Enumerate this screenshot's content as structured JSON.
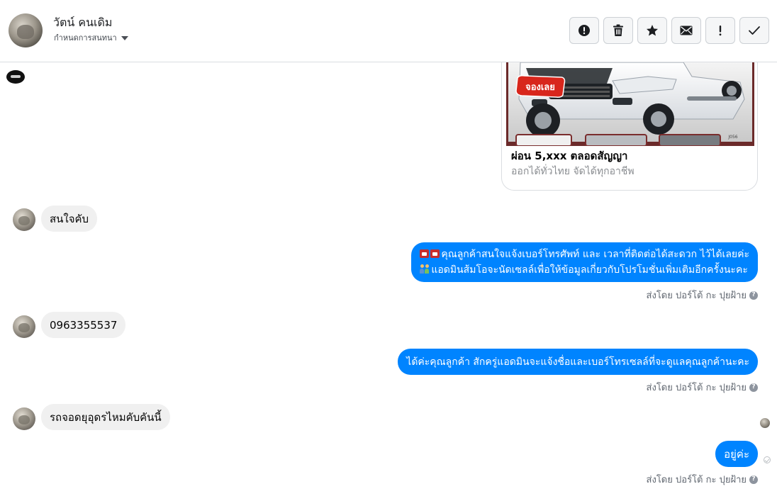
{
  "header": {
    "contact_name": "วัตน์ คนเดิม",
    "assign_label": "กำหนดการสนทนา",
    "toolbar": [
      {
        "name": "spam-button",
        "icon": "alert-circle-icon"
      },
      {
        "name": "delete-button",
        "icon": "trash-icon"
      },
      {
        "name": "star-button",
        "icon": "star-icon"
      },
      {
        "name": "mark-unread-button",
        "icon": "envelope-icon"
      },
      {
        "name": "follow-up-button",
        "icon": "exclamation-icon"
      },
      {
        "name": "mark-done-button",
        "icon": "checkmark-icon"
      }
    ]
  },
  "share_card": {
    "image_badge": "จองเลย",
    "image_code": "J056",
    "title": "ผ่อน 5,xxx ตลอดสัญญา",
    "subtitle": "ออกได้ทั่วไทย จัดได้ทุกอาชีพ"
  },
  "messages": [
    {
      "direction": "in",
      "text": "สนใจคับ"
    },
    {
      "direction": "out",
      "lines": [
        "คุณลูกค้าสนใจแจ้งเบอร์โทรศัพท์ และ เวลาที่ติดต่อได้สะดวก ไว้ได้เลยค่ะ",
        "แอดมินส้มโอจะนัดเซลล์เพื่อให้ข้อมูลเกี่ยวกับโปรโมชั่นเพิ่มเติมอีกครั้งนะคะ"
      ],
      "sent_by": "ส่งโดย ปอร์โต้ กะ ปุยฝ้าย"
    },
    {
      "direction": "in",
      "text": "0963355537"
    },
    {
      "direction": "out",
      "text": "ได้ค่ะคุณลูกค้า สักครู่แอดมินจะแจ้งชื่อและเบอร์โทรเซลล์ที่จะดูแลคุณลูกค้านะคะ",
      "sent_by": "ส่งโดย ปอร์โต้ กะ ปุยฝ้าย"
    },
    {
      "direction": "in",
      "text": "รถจอดยุอุดรไหมคับคันนี้"
    },
    {
      "direction": "out",
      "text": "อยู่ค่ะ",
      "sent_by": "ส่งโดย ปอร์โต้ กะ ปุยฝ้าย"
    }
  ],
  "colors": {
    "outgoing_bubble": "#0084ff",
    "incoming_bubble": "#f0f0f0",
    "card_image_border": "#6b2a2a",
    "badge_red": "#d8261c"
  }
}
